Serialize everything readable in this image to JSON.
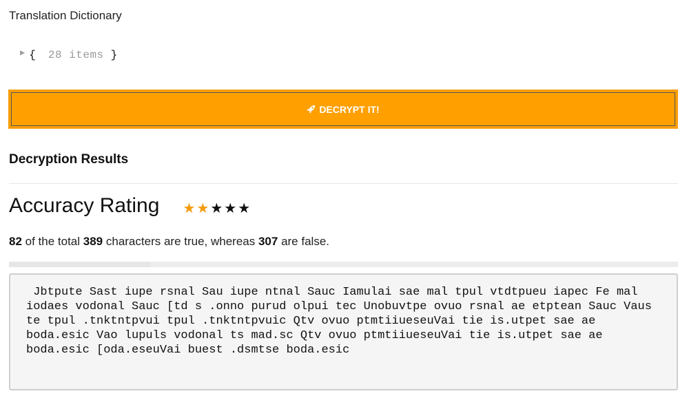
{
  "dictionary": {
    "title": "Translation Dictionary",
    "open_brace": "{",
    "close_brace": "}",
    "item_count_label": "28 items"
  },
  "decrypt": {
    "button_label": "DECRYPT IT!",
    "icon": "rocket-icon",
    "accent_color": "#ffa000"
  },
  "results": {
    "heading": "Decryption Results",
    "accuracy_title": "Accuracy Rating",
    "rating": {
      "filled": 2,
      "total": 5
    },
    "stats": {
      "true_count": "82",
      "text_1": " of the total ",
      "total": "389",
      "text_2": " characters are true, whereas ",
      "false_count": "307",
      "text_3": " are false."
    },
    "progress_fraction": 0.211,
    "decrypted_text": " Jbtpute Sast iupe rsnal Sau iupe ntnal Sauc Iamulai sae mal tpul vtdtpueu iapec Fe mal iodaes vodonal Sauc [td s .onno purud olpui tec Unobuvtpe ovuo rsnal ae etptean Sauc Vaus te tpul .tnktntpvui tpul .tnktntpvuic Qtv ovuo ptmtiiueseuVai tie is.utpet sae ae boda.esic Vao lupuls vodonal ts mad.sc Qtv ovuo ptmtiiueseuVai tie is.utpet sae ae boda.esic [oda.eseuVai buest .dsmtse boda.esic"
  }
}
